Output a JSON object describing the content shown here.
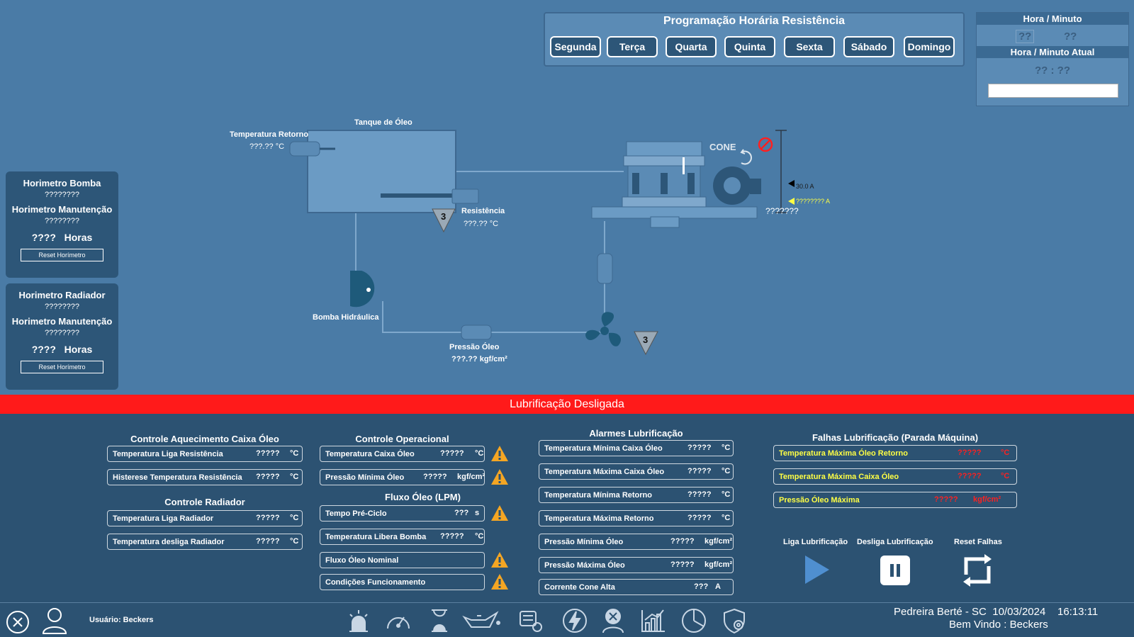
{
  "schedule": {
    "title": "Programação Horária Resistência",
    "days": [
      "Segunda",
      "Terça",
      "Quarta",
      "Quinta",
      "Sexta",
      "Sábado",
      "Domingo"
    ]
  },
  "hour_panel": {
    "title": "Hora / Minuto",
    "hour": "??",
    "minute": "??",
    "current_title": "Hora / Minuto Atual",
    "current_value": "?? : ??"
  },
  "horimetro_bomba": {
    "title": "Horimetro Bomba",
    "value": "????????",
    "maint_title": "Horimetro Manutenção",
    "maint_value": "????????",
    "hours_value": "????",
    "hours_unit": "Horas",
    "reset": "Reset Horímetro"
  },
  "horimetro_radiador": {
    "title": "Horimetro Radiador",
    "value": "????????",
    "maint_title": "Horimetro Manutenção",
    "maint_value": "????????",
    "hours_value": "????",
    "hours_unit": "Horas",
    "reset": "Reset Horímetro"
  },
  "diagram": {
    "temp_retorno_label": "Temperatura Retorno",
    "temp_retorno_value": "???.?? °C",
    "tanque_label": "Tanque de Óleo",
    "resistencia_label": "Resistência",
    "resistencia_value": "???.?? °C",
    "bomba_label": "Bomba Hidráulica",
    "pressao_label": "Pressão Óleo",
    "pressao_value": "???.?? kgf/cm²",
    "cone_label": "CONE",
    "current_setpoint": "30.0 A",
    "current_actual": "???????? A",
    "cone_value": "???????",
    "triangle_1": "3",
    "triangle_2": "3"
  },
  "status": "Lubrificação Desligada",
  "aquecimento": {
    "title": "Controle Aquecimento Caixa Óleo",
    "rows": [
      {
        "name": "Temperatura Liga Resistência",
        "value": "?????",
        "unit": "°C"
      },
      {
        "name": "Histerese Temperatura Resistência",
        "value": "?????",
        "unit": "°C"
      }
    ]
  },
  "radiador": {
    "title": "Controle Radiador",
    "rows": [
      {
        "name": "Temperatura Liga Radiador",
        "value": "?????",
        "unit": "°C"
      },
      {
        "name": "Temperatura desliga Radiador",
        "value": "?????",
        "unit": "°C"
      }
    ]
  },
  "operacional": {
    "title": "Controle Operacional",
    "rows": [
      {
        "name": "Temperatura Caixa Óleo",
        "value": "?????",
        "unit": "°C"
      },
      {
        "name": "Pressão Mínima Óleo",
        "value": "?????",
        "unit": "kgf/cm²"
      }
    ]
  },
  "fluxo": {
    "title": "Fluxo Óleo (LPM)",
    "rows": [
      {
        "name": "Tempo Pré-Ciclo",
        "value": "???",
        "unit": "s"
      },
      {
        "name": "Temperatura Libera Bomba",
        "value": "?????",
        "unit": "°C"
      },
      {
        "name": "Fluxo Óleo Nominal",
        "value": "",
        "unit": ""
      },
      {
        "name": "Condições Funcionamento",
        "value": "",
        "unit": ""
      }
    ]
  },
  "alarmes": {
    "title": "Alarmes Lubrificação",
    "rows": [
      {
        "name": "Temperatura Mínima Caixa Óleo",
        "value": "?????",
        "unit": "°C"
      },
      {
        "name": "Temperatura Máxima Caixa Óleo",
        "value": "?????",
        "unit": "°C"
      },
      {
        "name": "Temperatura Mínima Retorno",
        "value": "?????",
        "unit": "°C"
      },
      {
        "name": "Temperatura Máxima Retorno",
        "value": "?????",
        "unit": "°C"
      },
      {
        "name": "Pressão Mínima Óleo",
        "value": "?????",
        "unit": "kgf/cm²"
      },
      {
        "name": "Pressão Máxima Óleo",
        "value": "?????",
        "unit": "kgf/cm²"
      },
      {
        "name": "Corrente Cone Alta",
        "value": "???",
        "unit": "A"
      }
    ]
  },
  "falhas": {
    "title": "Falhas Lubrificação (Parada Máquina)",
    "rows": [
      {
        "name": "Temperatura Máxima Óleo Retorno",
        "value": "?????",
        "unit": "°C"
      },
      {
        "name": "Temperatura Máxima Caixa Óleo",
        "value": "?????",
        "unit": "°C"
      },
      {
        "name": "Pressão Óleo Máxima",
        "value": "?????",
        "unit": "kgf/cm²"
      }
    ]
  },
  "controls": {
    "liga": "Liga Lubrificação",
    "desliga": "Desliga Lubrificação",
    "reset": "Reset Falhas"
  },
  "footer": {
    "user": "Usuário: Beckers",
    "site": "Pedreira Berté - SC",
    "date": "10/03/2024",
    "time": "16:13:11",
    "welcome": "Bem Vindo : Beckers",
    "icons": [
      "alarm-icon",
      "gauge-icon",
      "hourglass-icon",
      "oil-can-icon",
      "pump-settings-icon",
      "lightning-icon",
      "operator-icon",
      "chart-icon",
      "pie-chart-icon",
      "settings-shield-icon"
    ]
  },
  "colors": {
    "background": "#4a7ba6",
    "panel": "#2c5272",
    "status_red": "#ff1a1a",
    "warning": "#f5a623",
    "fault_text": "#ffff44",
    "fault_value": "#ff2020"
  }
}
